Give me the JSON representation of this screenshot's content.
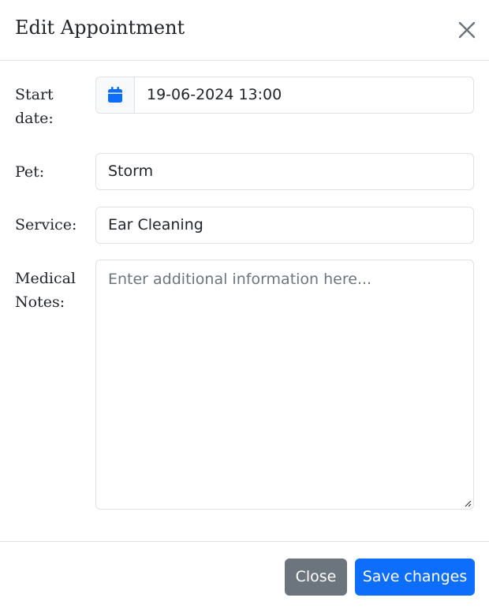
{
  "modal": {
    "title": "Edit Appointment"
  },
  "form": {
    "start_date": {
      "label_line1": "Start",
      "label_line2": "date:",
      "value": "19-06-2024 13:00",
      "icon": "calendar-icon"
    },
    "pet": {
      "label": "Pet:",
      "value": "Storm"
    },
    "service": {
      "label": "Service:",
      "value": "Ear Cleaning"
    },
    "medical_notes": {
      "label_line1": "Medical",
      "label_line2": "Notes:",
      "placeholder": "Enter additional information here..."
    }
  },
  "footer": {
    "close_label": "Close",
    "save_label": "Save changes"
  },
  "colors": {
    "primary": "#0d6efd",
    "secondary": "#6c757d",
    "border": "#dee2e6"
  }
}
